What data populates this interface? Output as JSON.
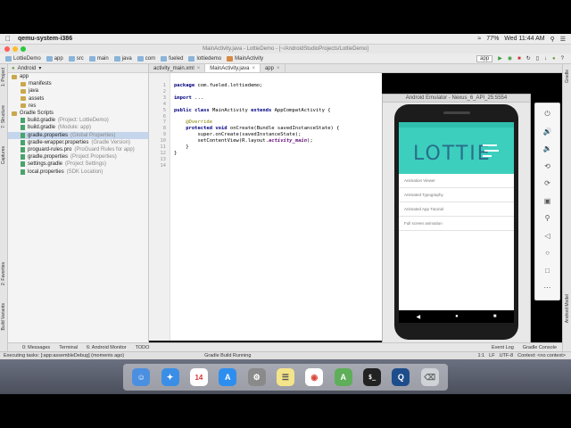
{
  "menubar": {
    "app_name": "qemu-system-i386",
    "battery": "77%",
    "clock": "Wed 11:44 AM"
  },
  "window": {
    "title": "MainActivity.java - LottieDemo - [~/AndroidStudioProjects/LottieDemo]"
  },
  "toolbar": {
    "breadcrumbs": [
      "LottieDemo",
      "app",
      "src",
      "main",
      "java",
      "com",
      "fueled",
      "lottiedemo",
      "MainActivity"
    ],
    "run_config": "app"
  },
  "project_panel": {
    "view_mode": "Android",
    "tree": [
      {
        "label": "app",
        "hint": "",
        "kind": "folder",
        "indent": 0
      },
      {
        "label": "manifests",
        "hint": "",
        "kind": "folder",
        "indent": 1
      },
      {
        "label": "java",
        "hint": "",
        "kind": "folder",
        "indent": 1
      },
      {
        "label": "assets",
        "hint": "",
        "kind": "folder",
        "indent": 1
      },
      {
        "label": "res",
        "hint": "",
        "kind": "folder",
        "indent": 1
      },
      {
        "label": "Gradle Scripts",
        "hint": "",
        "kind": "folder",
        "indent": 0
      },
      {
        "label": "build.gradle",
        "hint": "(Project: LottieDemo)",
        "kind": "gradle",
        "indent": 1
      },
      {
        "label": "build.gradle",
        "hint": "(Module: app)",
        "kind": "gradle",
        "indent": 1
      },
      {
        "label": "gradle.properties",
        "hint": "(Global Properties)",
        "kind": "gradle",
        "indent": 1
      },
      {
        "label": "gradle-wrapper.properties",
        "hint": "(Gradle Version)",
        "kind": "gradle",
        "indent": 1
      },
      {
        "label": "proguard-rules.pro",
        "hint": "(ProGuard Rules for app)",
        "kind": "gradle",
        "indent": 1
      },
      {
        "label": "gradle.properties",
        "hint": "(Project Properties)",
        "kind": "gradle",
        "indent": 1
      },
      {
        "label": "settings.gradle",
        "hint": "(Project Settings)",
        "kind": "gradle",
        "indent": 1
      },
      {
        "label": "local.properties",
        "hint": "(SDK Location)",
        "kind": "gradle",
        "indent": 1
      }
    ]
  },
  "left_tool_tabs": [
    "1: Project",
    "7: Structure",
    "Captures",
    "2: Favorites",
    "Build Variants"
  ],
  "right_tool_tabs": [
    "Gradle",
    "Android Model"
  ],
  "editor_tabs": [
    {
      "label": "activity_main.xml",
      "active": false
    },
    {
      "label": "MainActivity.java",
      "active": true
    },
    {
      "label": "app",
      "active": false
    }
  ],
  "code": {
    "line_numbers": [
      "1",
      "2",
      "3",
      "4",
      "5",
      "6",
      "7",
      "8",
      "9",
      "10",
      "11",
      "12",
      "13",
      "14"
    ],
    "package_kw": "package",
    "package_name": " com.fueled.lottiedemo;",
    "import_kw": "import",
    "import_rest": " ...",
    "class_kw1": "public class",
    "class_name": " MainActivity ",
    "class_kw2": "extends",
    "class_rest": " AppCompatActivity {",
    "override": "@Override",
    "method_kw": "protected void",
    "method_rest": " onCreate(Bundle savedInstanceState) {",
    "super_line": "super.onCreate(savedInstanceState);",
    "content_line": "setContentView(R.layout.",
    "content_it": "activity_main",
    "content_end": ");",
    "close1": "}",
    "close2": "}"
  },
  "emulator": {
    "title": "Android Emulator - Nexus_6_API_25:5554",
    "banner_text": "LOTTIE",
    "list_items": [
      "Animation Viewer",
      "Animated Typography",
      "Animated App Tutorial",
      "Full screen animation"
    ]
  },
  "bottom_tabs": {
    "left": [
      "0: Messages",
      "Terminal",
      "6: Android Monitor",
      "TODO"
    ],
    "right": [
      "Event Log",
      "Gradle Console"
    ]
  },
  "statusbar": {
    "left": "Executing tasks: [:app:assembleDebug] (moments ago)",
    "middle": "Gradle Build Running",
    "position": "1:1",
    "line_sep": "LF",
    "encoding": "UTF-8",
    "context": "Context: <no context>"
  },
  "dock": [
    "Finder",
    "Safari",
    "Calendar",
    "App Store",
    "System Preferences",
    "Notes",
    "Chrome",
    "Android Studio",
    "Terminal",
    "QEMU",
    "Trash"
  ]
}
